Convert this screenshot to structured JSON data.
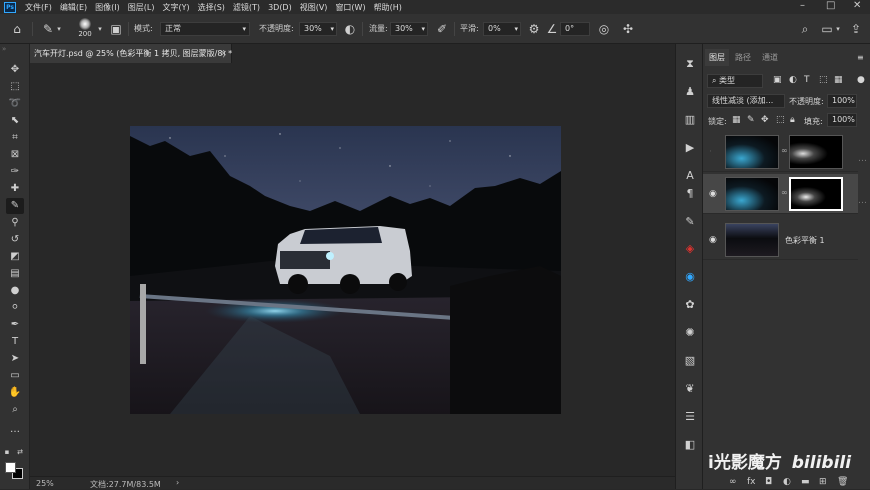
{
  "menubar": {
    "app_icon": "Ps",
    "items": [
      "文件(F)",
      "编辑(E)",
      "图像(I)",
      "图层(L)",
      "文字(Y)",
      "选择(S)",
      "滤镜(T)",
      "3D(D)",
      "视图(V)",
      "窗口(W)",
      "帮助(H)"
    ],
    "window_controls": [
      "minimize-icon",
      "maximize-icon",
      "close-icon"
    ]
  },
  "options": {
    "brush_size": "200",
    "mode_label": "模式:",
    "mode_value": "正常",
    "opacity_label": "不透明度:",
    "opacity_value": "30%",
    "flow_label": "流量:",
    "flow_value": "30%",
    "smoothing_label": "平滑:",
    "smoothing_value": "0%",
    "angle_value": "0°"
  },
  "document": {
    "tab_title": "汽车开灯.psd @ 25% (色彩平衡 1 拷贝, 图层蒙版/8) *",
    "zoom": "25%",
    "doc_info": "文档:27.7M/83.5M"
  },
  "layers_panel": {
    "tabs": [
      "图层",
      "路径",
      "通道"
    ],
    "filter_label": "类型",
    "blend_mode": "线性减淡 (添加...",
    "opacity_label": "不透明度:",
    "opacity_value": "100%",
    "lock_label": "锁定:",
    "fill_label": "填充:",
    "fill_value": "100%",
    "layers": [
      {
        "name": "",
        "visible": false
      },
      {
        "name": "",
        "visible": true
      },
      {
        "name": "色彩平衡 1",
        "visible": true
      }
    ]
  },
  "watermark": {
    "text": "i光影魔方",
    "brand": "bilibili"
  },
  "colors": {
    "accent": "#31a8ff",
    "panel": "#323232",
    "canvas_bg": "#282828"
  }
}
